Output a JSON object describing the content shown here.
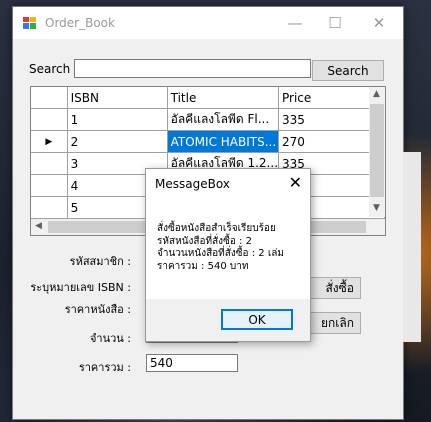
{
  "window": {
    "title": "Order_Book",
    "minimize": "—",
    "maximize": "☐",
    "close": "✕"
  },
  "search": {
    "label": "Search",
    "value": "",
    "button": "Search"
  },
  "grid": {
    "columns": [
      "ISBN",
      "Title",
      "Price"
    ],
    "current_row_marker": "▶",
    "rows": [
      {
        "isbn": "1",
        "title": "อัลคีแลงโลพีด Fl...",
        "price": "335"
      },
      {
        "isbn": "2",
        "title": "ATOMIC HABITS...",
        "price": "270"
      },
      {
        "isbn": "3",
        "title": "อัลคีแลงโลพีด 1.2...",
        "price": "335"
      },
      {
        "isbn": "4",
        "title": "",
        "price": ""
      },
      {
        "isbn": "5",
        "title": "",
        "price": ""
      }
    ]
  },
  "form": {
    "member_label": "รหัสสมาชิก :",
    "isbn_label": "ระบุหมายเลข ISBN :",
    "price_label": "ราคาหนังสือ :",
    "qty_label": "จำนวน :",
    "total_label": "ราคารวม :",
    "total_value": "540",
    "order_button": "สั่งซื้อ",
    "cancel_button": "ยกเลิก"
  },
  "messagebox": {
    "title": "MessageBox",
    "close": "✕",
    "lines": [
      "สั่งซื้อหนังสือสำเร็จเรียบร้อย",
      "รหัสหนังสือที่สั่งซื้อ : 2",
      "จำนวนหนังสือที่สั่งซื้อ : 2 เล่ม",
      "ราคารวม : 540 บาท"
    ],
    "ok": "OK"
  }
}
